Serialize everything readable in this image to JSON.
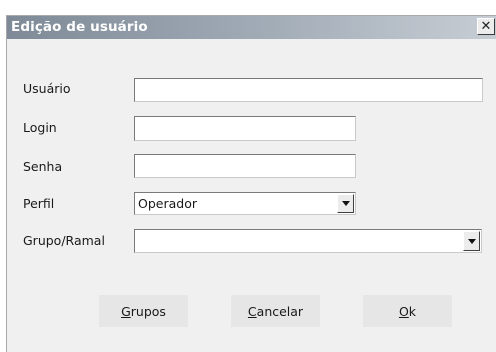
{
  "window": {
    "title": "Edição de usuário",
    "close_glyph": "✕"
  },
  "form": {
    "usuario": {
      "label": "Usuário",
      "value": ""
    },
    "login": {
      "label": "Login",
      "value": ""
    },
    "senha": {
      "label": "Senha",
      "value": ""
    },
    "perfil": {
      "label": "Perfil",
      "value": "Operador"
    },
    "grupo_ramal": {
      "label": "Grupo/Ramal",
      "value": ""
    }
  },
  "buttons": {
    "grupos": {
      "mnemonic": "G",
      "rest": "rupos"
    },
    "cancelar": {
      "mnemonic": "C",
      "rest": "ancelar"
    },
    "ok": {
      "mnemonic": "O",
      "rest": "k"
    }
  }
}
